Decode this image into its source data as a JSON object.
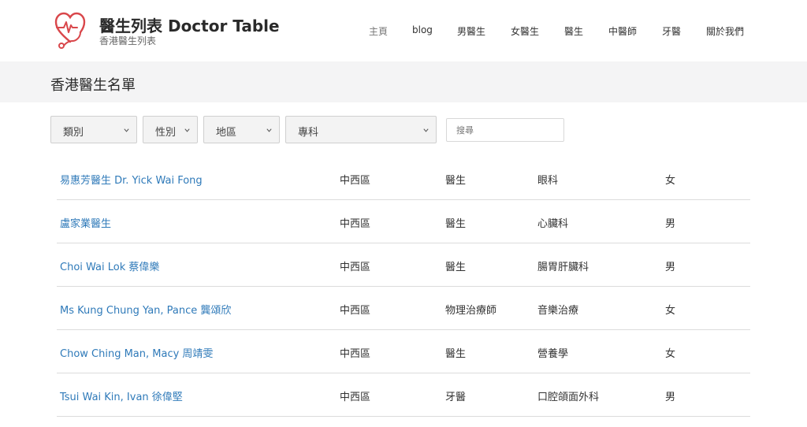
{
  "header": {
    "site_title": "醫生列表 Doctor Table",
    "site_subtitle": "香港醫生列表",
    "nav": [
      {
        "label": "主頁",
        "active": true
      },
      {
        "label": "blog"
      },
      {
        "label": "男醫生"
      },
      {
        "label": "女醫生"
      },
      {
        "label": "醫生"
      },
      {
        "label": "中醫師"
      },
      {
        "label": "牙醫"
      },
      {
        "label": "關於我們"
      }
    ],
    "brand_color": "#d9474b"
  },
  "page": {
    "title": "香港醫生名單"
  },
  "filters": {
    "category": "類別",
    "gender": "性別",
    "district": "地區",
    "specialty": "專科",
    "search_placeholder": "搜尋"
  },
  "table": {
    "rows": [
      {
        "name": "易惠芳醫生 Dr. Yick Wai Fong",
        "district": "中西區",
        "type": "醫生",
        "specialty": "眼科",
        "gender": "女"
      },
      {
        "name": "盧家業醫生",
        "district": "中西區",
        "type": "醫生",
        "specialty": "心臟科",
        "gender": "男"
      },
      {
        "name": "Choi Wai Lok 蔡偉樂",
        "district": "中西區",
        "type": "醫生",
        "specialty": "腸胃肝臟科",
        "gender": "男"
      },
      {
        "name": "Ms Kung Chung Yan, Pance 龔頌欣",
        "district": "中西區",
        "type": "物理治療師",
        "specialty": "音樂治療",
        "gender": "女"
      },
      {
        "name": "Chow Ching Man, Macy 周靖雯",
        "district": "中西區",
        "type": "醫生",
        "specialty": "營養學",
        "gender": "女"
      },
      {
        "name": "Tsui Wai Kin, Ivan 徐偉堅",
        "district": "中西區",
        "type": "牙醫",
        "specialty": "口腔頜面外科",
        "gender": "男"
      }
    ]
  },
  "colors": {
    "link": "#2f7ab9",
    "title_bar_bg": "#f4f4f5"
  }
}
